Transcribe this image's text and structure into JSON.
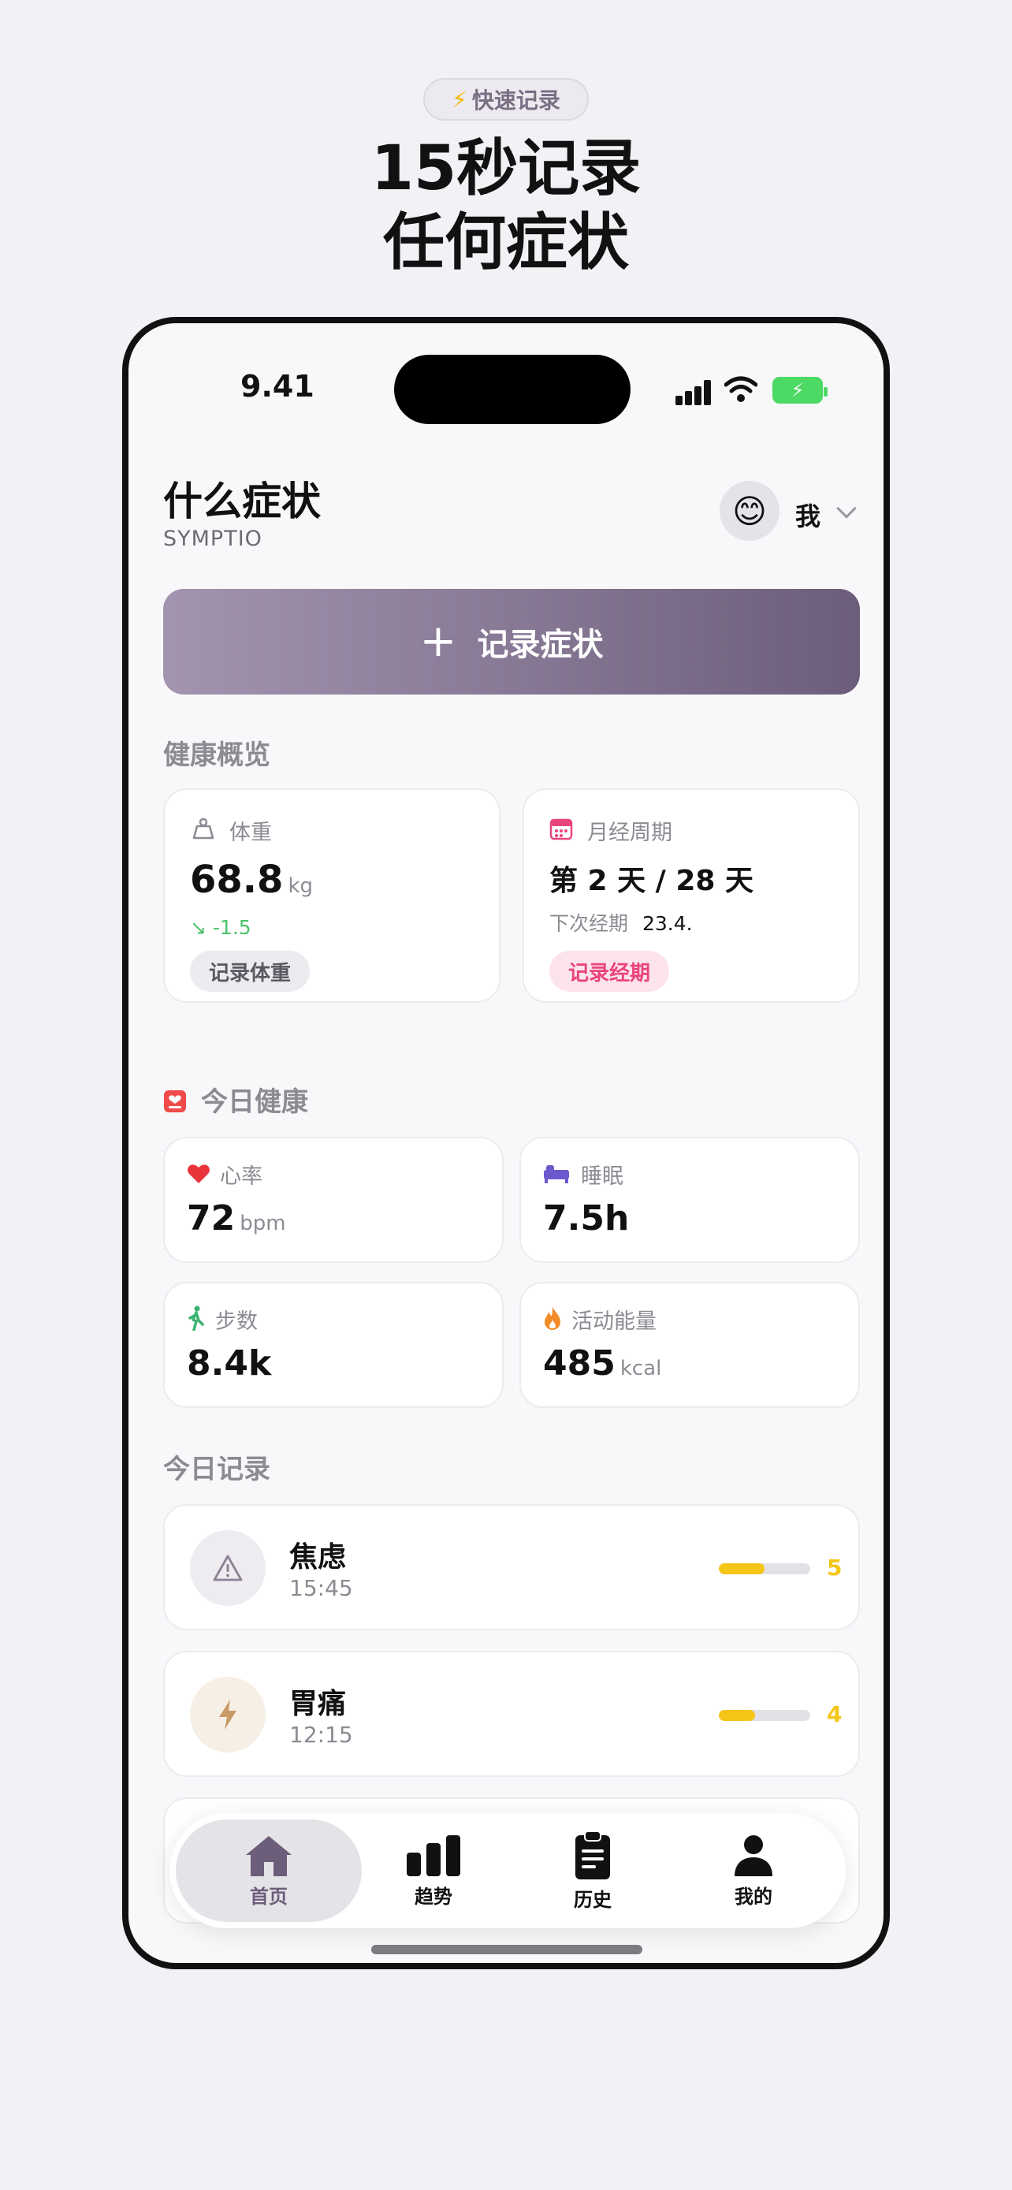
{
  "promo": {
    "badge_icon": "⚡",
    "badge": "快速记录",
    "headline_line1": "15秒记录",
    "headline_line2": "任何症状"
  },
  "status_bar": {
    "time": "9.41"
  },
  "header": {
    "title": "什么症状",
    "subtitle": "SYMPTIO",
    "avatar_emoji": "😊",
    "profile_label": "我"
  },
  "record_button": {
    "label": "记录症状"
  },
  "overview": {
    "section_title": "健康概览",
    "weight": {
      "label": "体重",
      "value": "68.8",
      "unit": "kg",
      "delta": "↘ -1.5",
      "action": "记录体重"
    },
    "cycle": {
      "label": "月经周期",
      "value": "第 2 天 / 28 天",
      "next_label": "下次经期",
      "next_value": "23.4.",
      "action": "记录经期"
    }
  },
  "today_health": {
    "section_title": "今日健康",
    "heart": {
      "label": "心率",
      "value": "72",
      "unit": "bpm"
    },
    "sleep": {
      "label": "睡眠",
      "value": "7.5h"
    },
    "steps": {
      "label": "步数",
      "value": "8.4k"
    },
    "energy": {
      "label": "活动能量",
      "value": "485",
      "unit": "kcal"
    }
  },
  "today_records": {
    "section_title": "今日记录",
    "items": [
      {
        "name": "焦虑",
        "time": "15:45",
        "score": "5",
        "level": 0.5,
        "icon": "warning-icon"
      },
      {
        "name": "胃痛",
        "time": "12:15",
        "score": "4",
        "level": 0.4,
        "icon": "bolt-icon"
      }
    ]
  },
  "tabbar": {
    "tabs": [
      {
        "label": "首页",
        "icon": "home-icon"
      },
      {
        "label": "趋势",
        "icon": "bar-chart-icon"
      },
      {
        "label": "历史",
        "icon": "clipboard-icon"
      },
      {
        "label": "我的",
        "icon": "person-icon"
      }
    ]
  },
  "colors": {
    "accent": "#7a6b88",
    "score": "#f5c518",
    "cycle_pink": "#e8457a",
    "heart_red": "#e8343b",
    "sleep_purple": "#6a5acd",
    "steps_green": "#3cb371",
    "energy_orange": "#f28c28",
    "weight_delta_green": "#4cc26b"
  }
}
